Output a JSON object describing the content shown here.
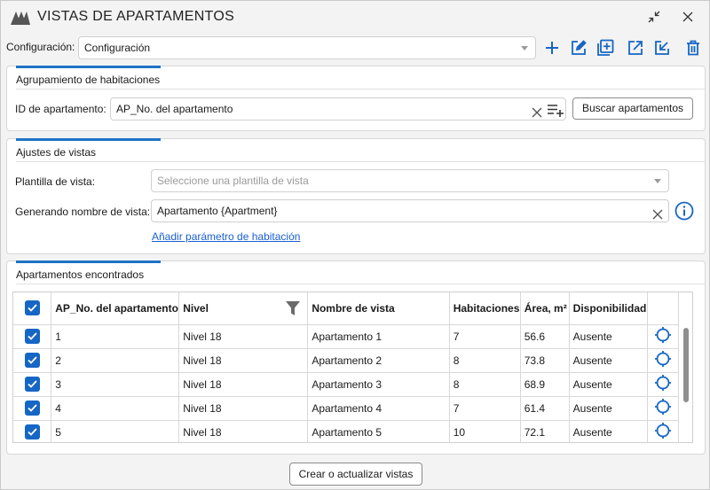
{
  "window": {
    "title": "VISTAS DE APARTAMENTOS"
  },
  "config": {
    "label": "Configuración:",
    "value": "Configuración"
  },
  "grouping": {
    "title": "Agrupamiento de habitaciones",
    "id_label": "ID de apartamento:",
    "id_value": "AP_No. del apartamento",
    "search_button": "Buscar apartamentos"
  },
  "view_settings": {
    "title": "Ajustes de vistas",
    "template_label": "Plantilla de vista:",
    "template_placeholder": "Seleccione una plantilla de vista",
    "name_label": "Generando nombre de vista:",
    "name_value": "Apartamento {Apartment}",
    "add_param_link": "Añadir parámetro de habitación"
  },
  "found": {
    "title": "Apartamentos encontrados",
    "columns": [
      "AP_No. del apartamento",
      "Nivel",
      "Nombre de vista",
      "Habitaciones",
      "Área, m²",
      "Disponibilidad"
    ],
    "rows": [
      {
        "id": "1",
        "level": "Nivel 18",
        "view": "Apartamento 1",
        "rooms": "7",
        "area": "56.6",
        "avail": "Ausente"
      },
      {
        "id": "2",
        "level": "Nivel 18",
        "view": "Apartamento 2",
        "rooms": "8",
        "area": "73.8",
        "avail": "Ausente"
      },
      {
        "id": "3",
        "level": "Nivel 18",
        "view": "Apartamento 3",
        "rooms": "8",
        "area": "68.9",
        "avail": "Ausente"
      },
      {
        "id": "4",
        "level": "Nivel 18",
        "view": "Apartamento 4",
        "rooms": "7",
        "area": "61.4",
        "avail": "Ausente"
      },
      {
        "id": "5",
        "level": "Nivel 18",
        "view": "Apartamento 5",
        "rooms": "10",
        "area": "72.1",
        "avail": "Ausente"
      }
    ]
  },
  "footer": {
    "create_button": "Crear o actualizar vistas"
  },
  "colors": {
    "accent": "#1e73c8",
    "checkbox": "#1666c5"
  }
}
